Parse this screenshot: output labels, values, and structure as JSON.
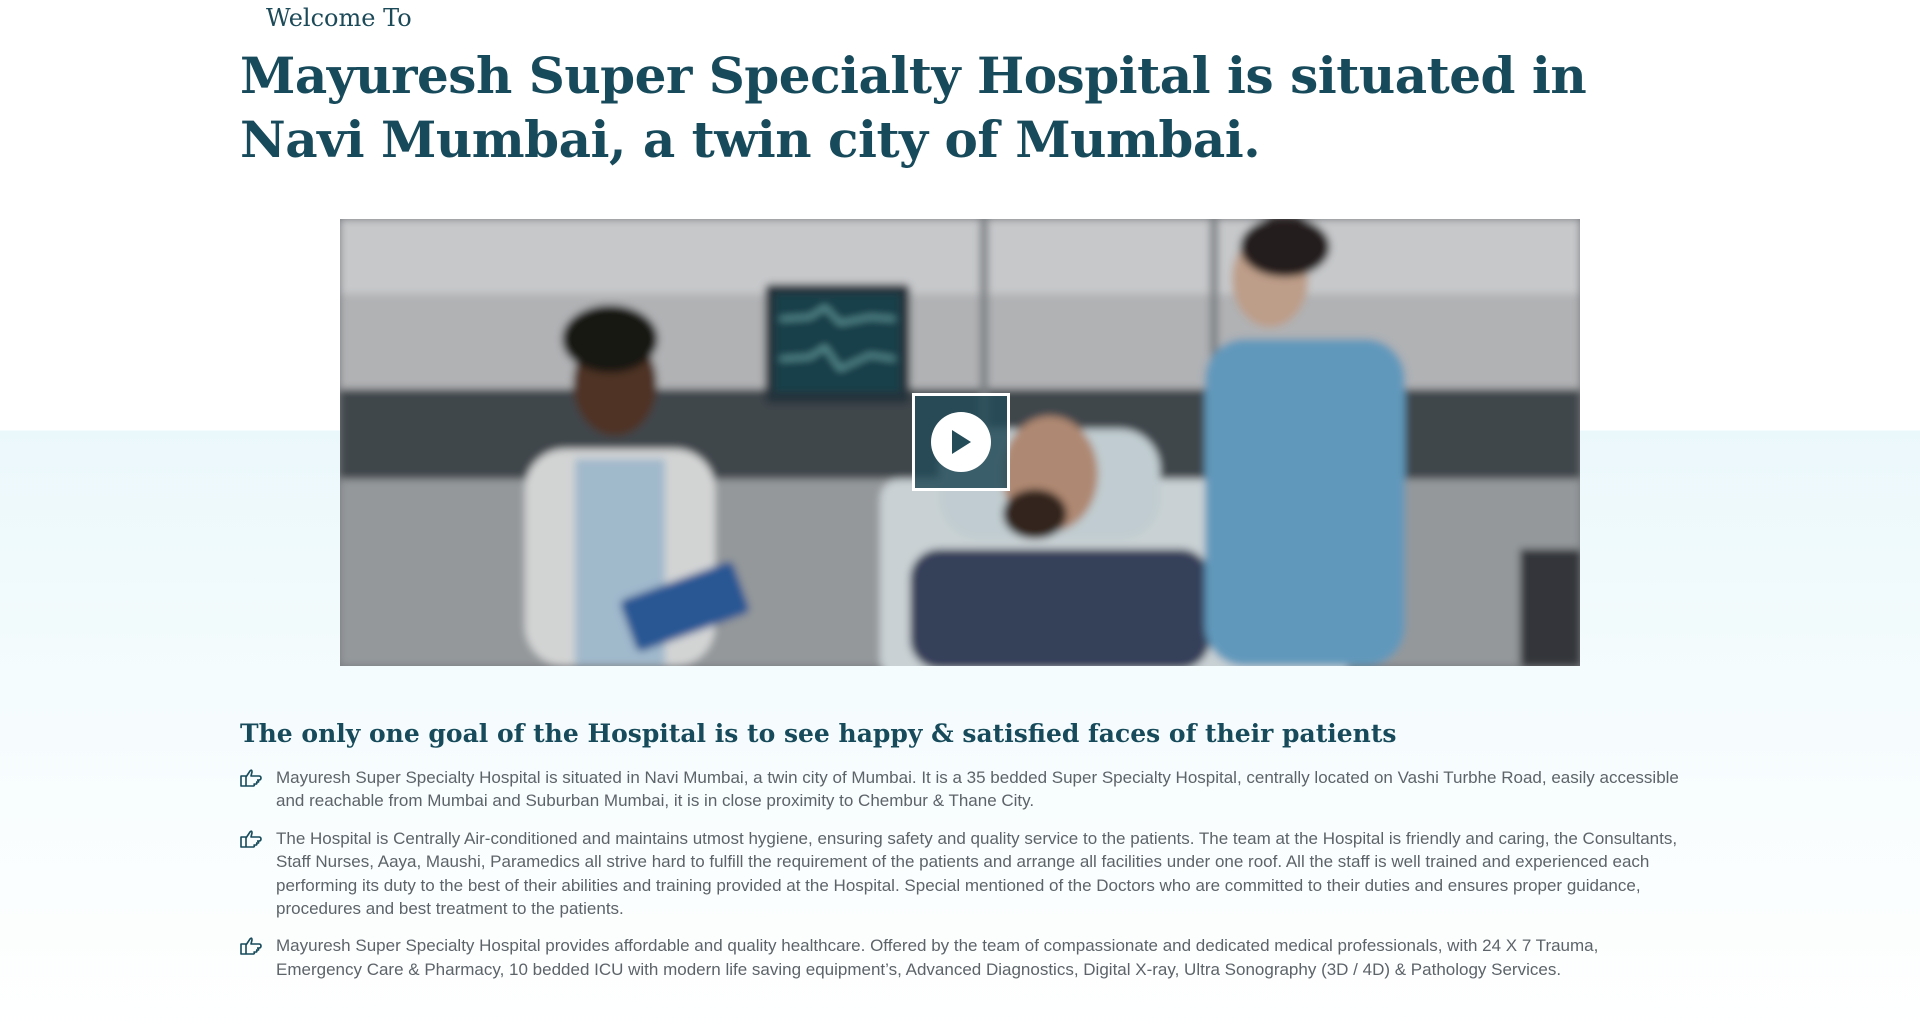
{
  "section": {
    "eyebrow": "Welcome To",
    "headline": "Mayuresh Super Specialty Hospital is situated in Navi Mumbai, a twin city of Mumbai.",
    "subheading": "The only one goal of the Hospital is to see happy & satisfied faces of their patients"
  },
  "video": {
    "play_icon": "play-icon",
    "scene": "doctor, patient in hospital bed and nurse"
  },
  "features": [
    {
      "icon": "pointing-hand-icon",
      "text": "Mayuresh Super Specialty Hospital is situated in Navi Mumbai, a twin city of Mumbai. It is a 35 bedded Super Specialty Hospital, centrally located on Vashi Turbhe Road, easily accessible and reachable from Mumbai and Suburban Mumbai, it is in close proximity to Chembur & Thane City."
    },
    {
      "icon": "pointing-hand-icon",
      "text": "The Hospital is Centrally Air-conditioned and maintains utmost hygiene, ensuring safety and quality service to the patients. The team at the Hospital is friendly and caring, the Consultants, Staff Nurses, Aaya, Maushi, Paramedics all strive hard to fulfill the requirement of the patients and arrange all facilities under one roof. All the staff is well trained and experienced each performing its duty to the best of their abilities and training provided at the Hospital. Special mentioned of the Doctors who are committed to their duties and ensures proper guidance, procedures and best treatment to the patients."
    },
    {
      "icon": "pointing-hand-icon",
      "text": "Mayuresh Super Specialty Hospital provides affordable and quality healthcare. Offered by the team of compassionate and dedicated medical professionals, with 24 X 7 Trauma, Emergency Care & Pharmacy, 10 bedded ICU with modern life saving equipment’s, Advanced Diagnostics, Digital X-ray, Ultra Sonography (3D / 4D) & Pathology Services."
    }
  ],
  "colors": {
    "heading": "#174a5b",
    "body_text": "#5d6469",
    "section_bg": "#ebf8fb",
    "play_overlay": "#234b58"
  }
}
